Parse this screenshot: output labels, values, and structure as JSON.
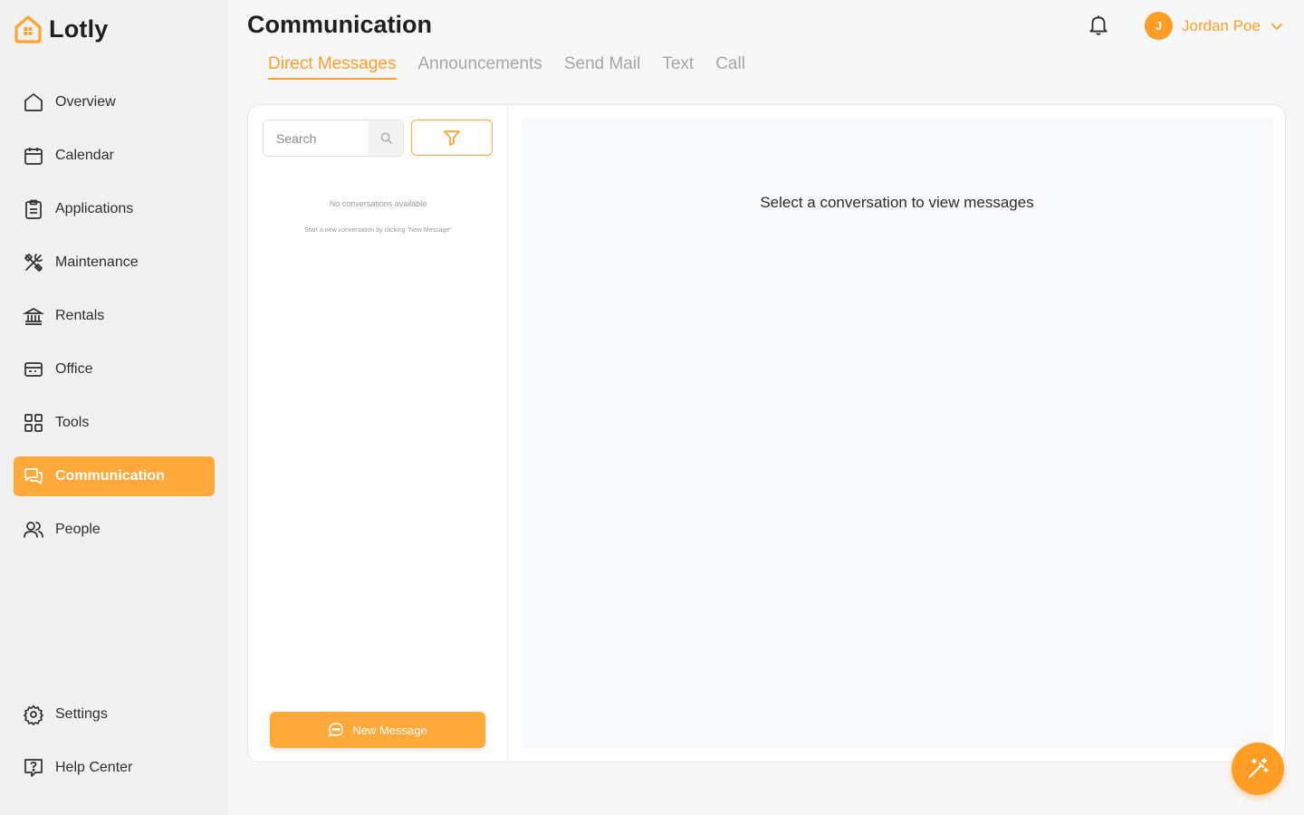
{
  "app": {
    "name": "Lotly"
  },
  "colors": {
    "accent": "#ffa93a",
    "accent_text": "#ff9f29",
    "sidebar_bg": "#f1f1f1"
  },
  "sidebar": {
    "items": [
      {
        "label": "Overview",
        "icon": "home-icon"
      },
      {
        "label": "Calendar",
        "icon": "calendar-icon"
      },
      {
        "label": "Applications",
        "icon": "clipboard-icon"
      },
      {
        "label": "Maintenance",
        "icon": "tools-icon"
      },
      {
        "label": "Rentals",
        "icon": "bank-icon"
      },
      {
        "label": "Office",
        "icon": "office-icon"
      },
      {
        "label": "Tools",
        "icon": "grid-icon"
      },
      {
        "label": "Communication",
        "icon": "chat-icon",
        "active": true
      },
      {
        "label": "People",
        "icon": "people-icon"
      }
    ],
    "bottom": [
      {
        "label": "Settings",
        "icon": "gear-icon"
      },
      {
        "label": "Help Center",
        "icon": "help-icon"
      }
    ]
  },
  "header": {
    "title": "Communication",
    "tabs": [
      {
        "label": "Direct Messages",
        "active": true
      },
      {
        "label": "Announcements"
      },
      {
        "label": "Send Mail"
      },
      {
        "label": "Text"
      },
      {
        "label": "Call"
      }
    ],
    "user": {
      "initial": "J",
      "name": "Jordan Poe"
    }
  },
  "conversations": {
    "search_placeholder": "Search",
    "empty_title": "No conversations available",
    "empty_subtitle": "Start a new conversation by clicking \"New Message\"",
    "new_message_label": "New Message"
  },
  "message_view": {
    "placeholder": "Select a conversation to view messages"
  }
}
